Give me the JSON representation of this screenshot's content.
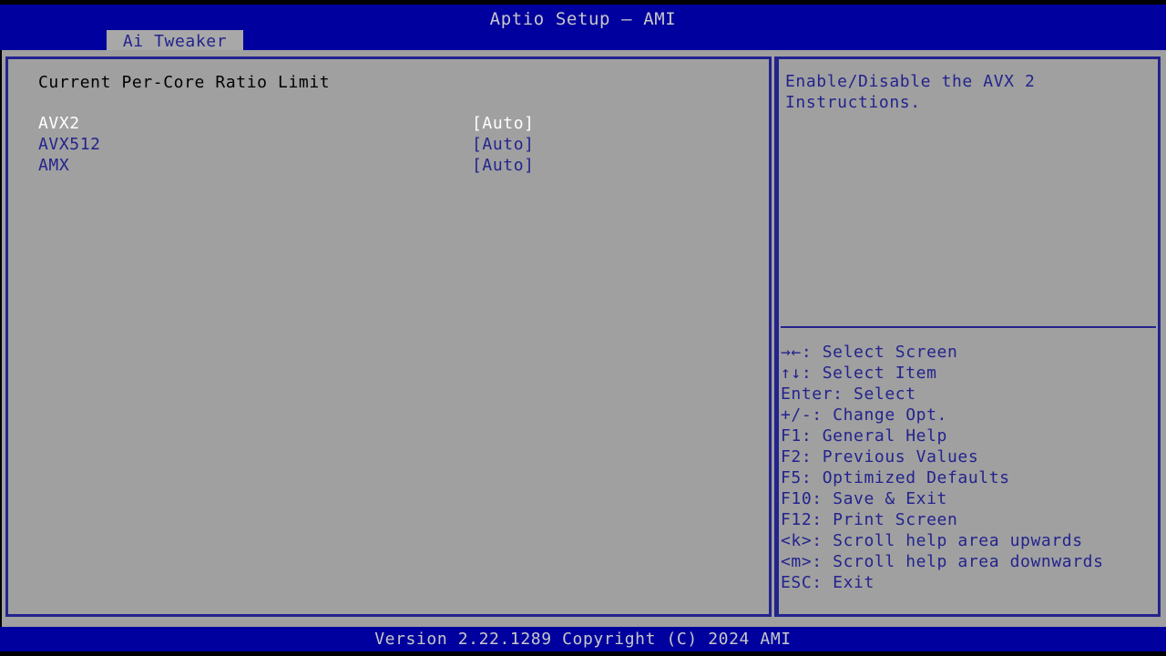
{
  "window": {
    "title": "Aptio Setup – AMI",
    "accent_blue": "#00009e",
    "panel_gray": "#a0a0a0",
    "text_blue": "#23238e",
    "selected_text": "#ffffff"
  },
  "tabs": [
    {
      "label": "Ai Tweaker",
      "active": true
    }
  ],
  "main": {
    "section_title": "Current Per-Core Ratio Limit",
    "options": [
      {
        "label": "AVX2",
        "value": "[Auto]",
        "selected": true
      },
      {
        "label": "AVX512",
        "value": "[Auto]",
        "selected": false
      },
      {
        "label": "AMX",
        "value": "[Auto]",
        "selected": false
      }
    ]
  },
  "help": {
    "description": "Enable/Disable the AVX 2 Instructions.",
    "legend": [
      {
        "keys": "→←: Select Screen"
      },
      {
        "keys": "↑↓: Select Item"
      },
      {
        "keys": "Enter: Select"
      },
      {
        "keys": "+/-: Change Opt."
      },
      {
        "keys": "F1: General Help"
      },
      {
        "keys": "F2: Previous Values"
      },
      {
        "keys": "F5: Optimized Defaults"
      },
      {
        "keys": "F10: Save & Exit"
      },
      {
        "keys": "F12: Print Screen"
      },
      {
        "keys": "<k>: Scroll help area upwards"
      },
      {
        "keys": "<m>: Scroll help area downwards"
      },
      {
        "keys": "ESC: Exit"
      }
    ]
  },
  "footer": {
    "version_text": "Version 2.22.1289 Copyright (C) 2024 AMI"
  }
}
